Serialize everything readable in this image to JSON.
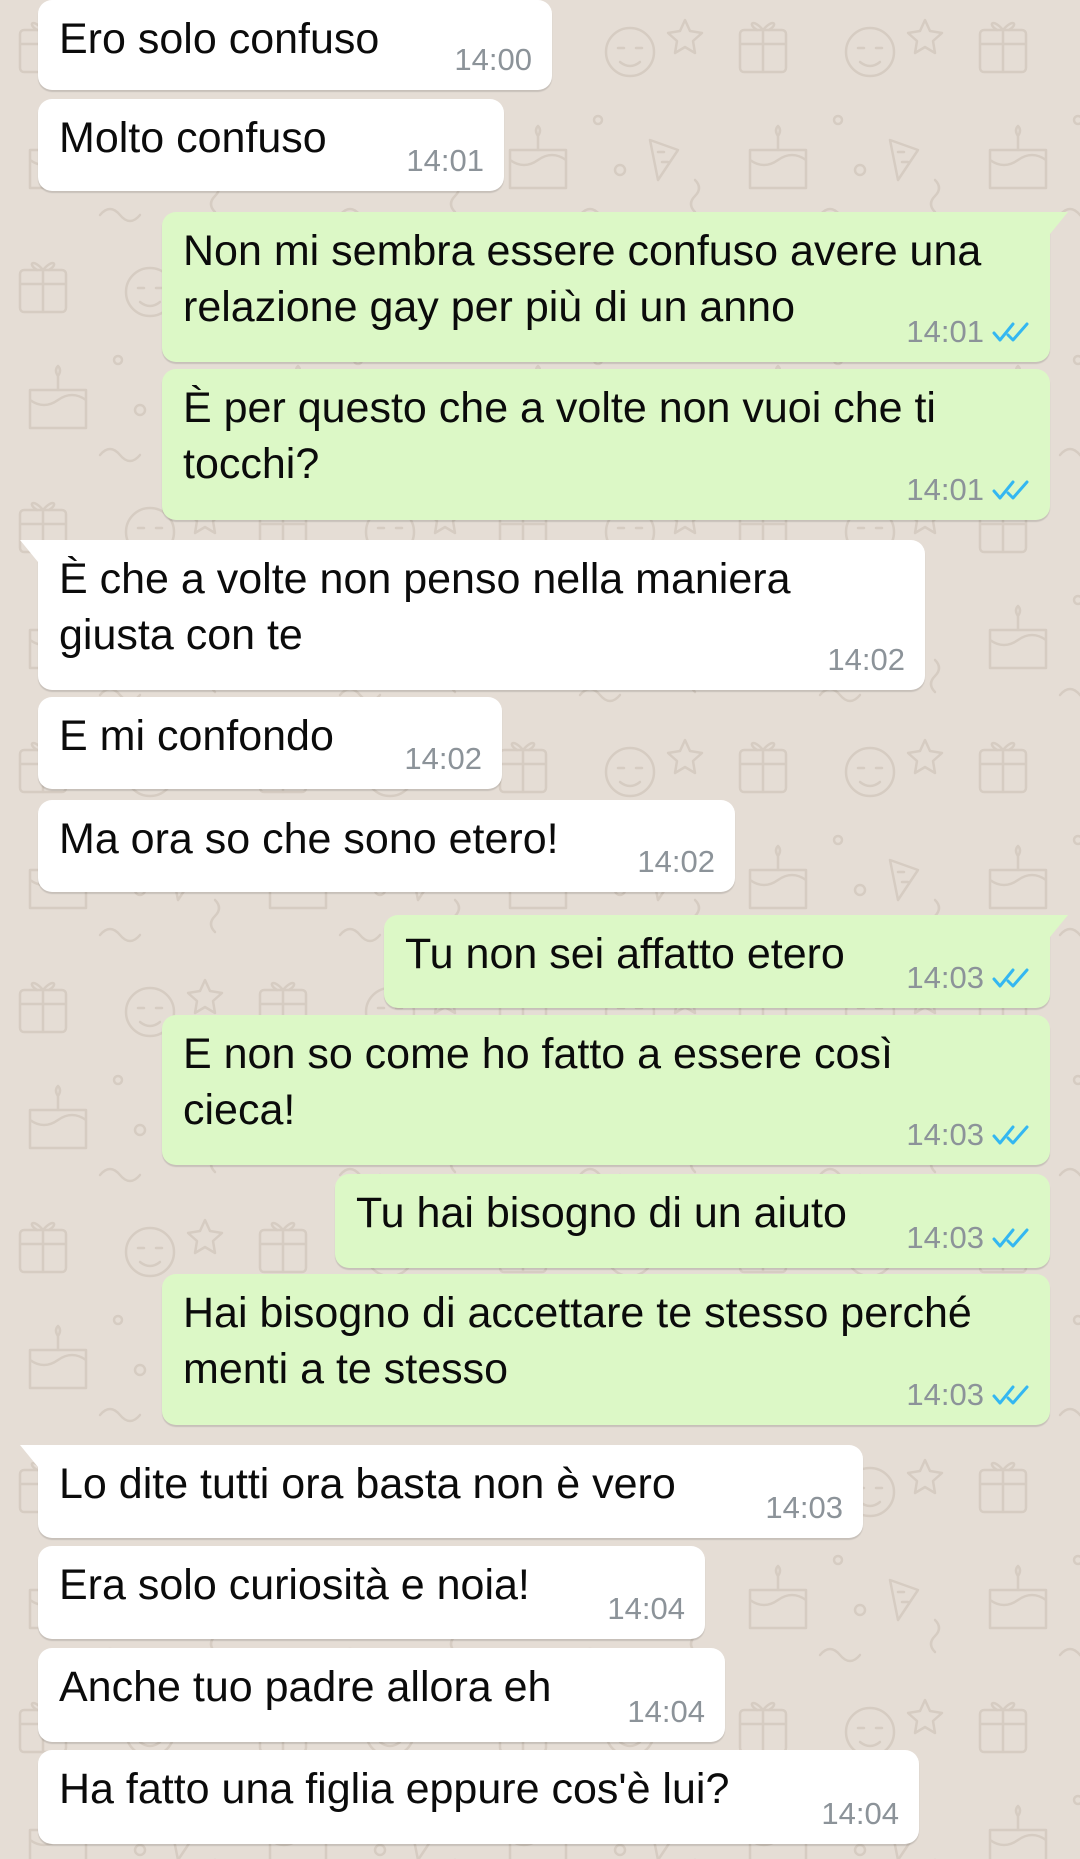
{
  "chat": {
    "messages": [
      {
        "dir": "in",
        "text": "Ero solo confuso",
        "time": "14:00",
        "tail": false
      },
      {
        "dir": "in",
        "text": "Molto confuso",
        "time": "14:01",
        "tail": false
      },
      {
        "dir": "out",
        "text": "Non mi sembra essere confuso avere una relazione gay per più di un anno",
        "time": "14:01",
        "tail": true,
        "status": "read"
      },
      {
        "dir": "out",
        "text": "È per questo che a volte non vuoi che ti tocchi?",
        "time": "14:01",
        "tail": false,
        "status": "read"
      },
      {
        "dir": "in",
        "text": "È che a volte non penso nella maniera giusta con te",
        "time": "14:02",
        "tail": true
      },
      {
        "dir": "in",
        "text": "E mi confondo",
        "time": "14:02",
        "tail": false
      },
      {
        "dir": "in",
        "text": "Ma ora so che sono etero!",
        "time": "14:02",
        "tail": false
      },
      {
        "dir": "out",
        "text": "Tu non sei affatto etero",
        "time": "14:03",
        "tail": true,
        "status": "read"
      },
      {
        "dir": "out",
        "text": "E non so come ho fatto a essere così cieca!",
        "time": "14:03",
        "tail": false,
        "status": "read"
      },
      {
        "dir": "out",
        "text": "Tu hai bisogno di un aiuto",
        "time": "14:03",
        "tail": false,
        "status": "read"
      },
      {
        "dir": "out",
        "text": "Hai bisogno di accettare te stesso perché menti a te stesso",
        "time": "14:03",
        "tail": false,
        "status": "read"
      },
      {
        "dir": "in",
        "text": "Lo dite tutti ora basta non è vero",
        "time": "14:03",
        "tail": true
      },
      {
        "dir": "in",
        "text": "Era solo curiosità e noia!",
        "time": "14:04",
        "tail": false
      },
      {
        "dir": "in",
        "text": "Anche tuo padre allora eh",
        "time": "14:04",
        "tail": false
      },
      {
        "dir": "in",
        "text": "Ha fatto una figlia eppure cos'è lui?",
        "time": "14:04",
        "tail": false
      }
    ]
  },
  "colors": {
    "wallpaper": "#e5ddd5",
    "incoming_bubble": "#ffffff",
    "outgoing_bubble": "#dcf8c6",
    "timestamp": "#8c9399",
    "read_ticks": "#34b7f1"
  },
  "icons": {
    "read_receipt": "double-check-icon"
  }
}
